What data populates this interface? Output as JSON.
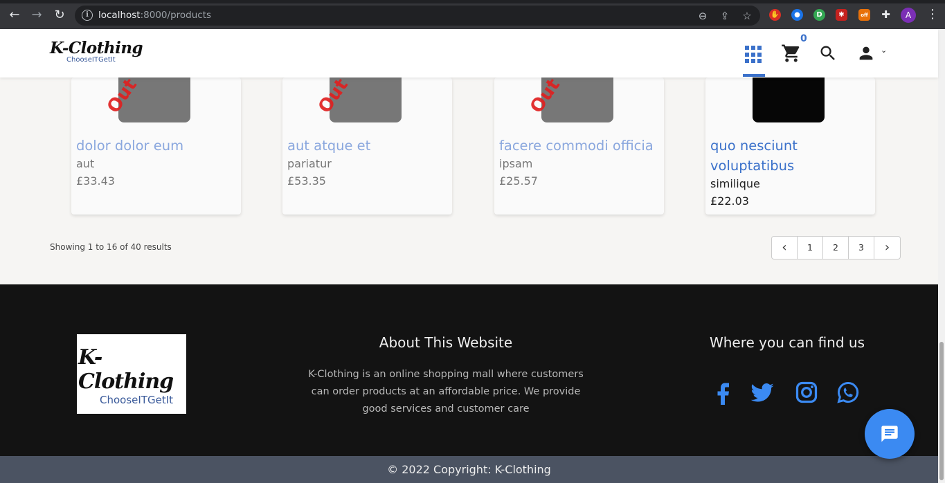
{
  "browser": {
    "url_host": "localhost",
    "url_path": ":8000/products",
    "profile_initial": "A",
    "ext_off_label": "off"
  },
  "header": {
    "logo_text": "K-Clothing",
    "logo_tagline": "ChooseITGetIt",
    "cart_count": "0",
    "accent_color": "#3b71ca"
  },
  "products": [
    {
      "name": "dolor dolor eum",
      "category": "aut",
      "price": "£33.43",
      "stock_label": "Out of Stock"
    },
    {
      "name": "aut atque et",
      "category": "pariatur",
      "price": "£53.35",
      "stock_label": "Out of Stock"
    },
    {
      "name": "facere commodi officia",
      "category": "ipsam",
      "price": "£25.57",
      "stock_label": "Out of Stock"
    },
    {
      "name": "quo nesciunt voluptatibus",
      "category": "similique",
      "price": "£22.03"
    }
  ],
  "pagination": {
    "summary": "Showing 1 to 16 of 40 results",
    "prev": "‹",
    "pages": [
      "1",
      "2",
      "3"
    ],
    "next": "›"
  },
  "footer": {
    "logo_text": "K-Clothing",
    "logo_tagline": "ChooseITGetIt",
    "about_title": "About This Website",
    "about_text": "K-Clothing is an online shopping mall where customers can order products at an affordable price. We provide good services and customer care",
    "find_title": "Where you can find us",
    "social_icons": [
      "facebook-icon",
      "twitter-icon",
      "instagram-icon",
      "whatsapp-icon"
    ],
    "social_color": "#3b8af2",
    "copyright": "© 2022 Copyright: K-Clothing"
  }
}
